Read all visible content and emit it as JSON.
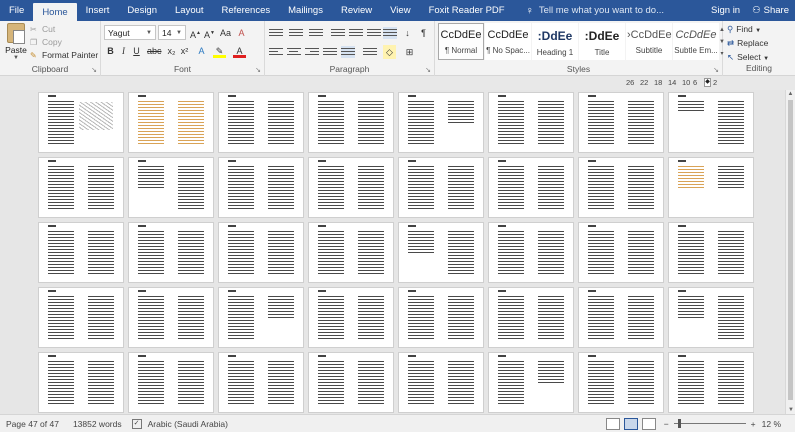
{
  "tabs": [
    "File",
    "Home",
    "Insert",
    "Design",
    "Layout",
    "References",
    "Mailings",
    "Review",
    "View",
    "Foxit Reader PDF"
  ],
  "active_tab": "Home",
  "tell_me": "Tell me what you want to do...",
  "account": {
    "sign_in": "Sign in",
    "share": "Share"
  },
  "clipboard": {
    "paste": "Paste",
    "cut": "Cut",
    "copy": "Copy",
    "format_painter": "Format Painter",
    "label": "Clipboard"
  },
  "font": {
    "name": "Yagut",
    "size": "14",
    "label": "Font"
  },
  "paragraph": {
    "label": "Paragraph"
  },
  "styles": {
    "label": "Styles",
    "tiles": [
      {
        "preview": "CcDdEe",
        "name": "¶ Normal"
      },
      {
        "preview": "CcDdEe",
        "name": "¶ No Spac..."
      },
      {
        "preview": ":DdEe",
        "name": "Heading 1"
      },
      {
        "preview": ":DdEe",
        "name": "Title"
      },
      {
        "preview": "›CcDdEe",
        "name": "Subtitle"
      },
      {
        "preview": "CcDdEe",
        "name": "Subtle Em..."
      }
    ]
  },
  "editing": {
    "find": "Find",
    "replace": "Replace",
    "select": "Select",
    "label": "Editing"
  },
  "ruler_numbers": [
    "26",
    "22",
    "18",
    "14",
    "10",
    "6",
    "2"
  ],
  "status": {
    "page": "Page 47 of 47",
    "words": "13852 words",
    "language": "Arabic (Saudi Arabia)",
    "zoom": "12 %"
  },
  "colors": {
    "accent": "#2b579a",
    "ribbon": "#f3f3f3",
    "workspace": "#e6e6e6"
  }
}
